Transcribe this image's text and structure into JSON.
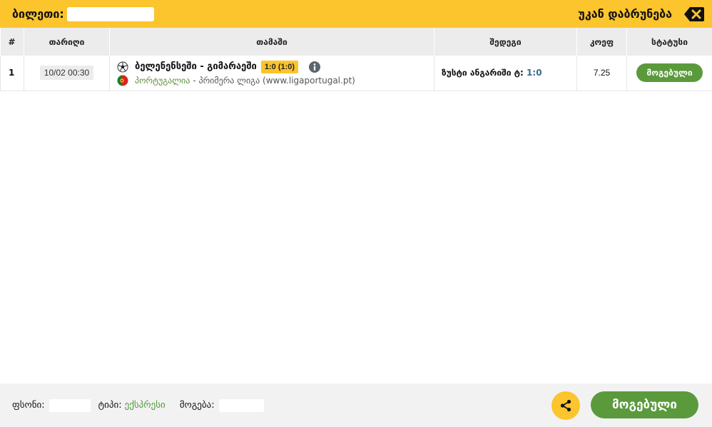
{
  "header": {
    "ticket_label": "ბილეთი:",
    "back_label": "უკან დაბრუნება",
    "back_icon": "backspace-close-icon"
  },
  "table": {
    "columns": [
      "#",
      "თარიღი",
      "თამაში",
      "შედეგი",
      "კოეფ",
      "სტატუსი"
    ],
    "rows": [
      {
        "num": "1",
        "date": "10/02 00:30",
        "teams": "ბელენენსეში - გიმარაეში",
        "score": "1:0 (1:0)",
        "country": "პორტუგალია",
        "league": "- პრიმერა ლიგა (www.ligaportugal.pt)",
        "bet_label": "ზუსტი ანგარიში ტ:",
        "bet_value": "1:0",
        "odd": "7.25",
        "status": "მოგებული"
      }
    ]
  },
  "footer": {
    "stake_label": "ფსონი:",
    "type_label": "ტიპი:",
    "type_value": "ექსპრესი",
    "win_label": "მოგება:",
    "status_button": "მოგებული"
  },
  "colors": {
    "accent": "#fcc42d",
    "win_green": "#5a9a3c"
  }
}
